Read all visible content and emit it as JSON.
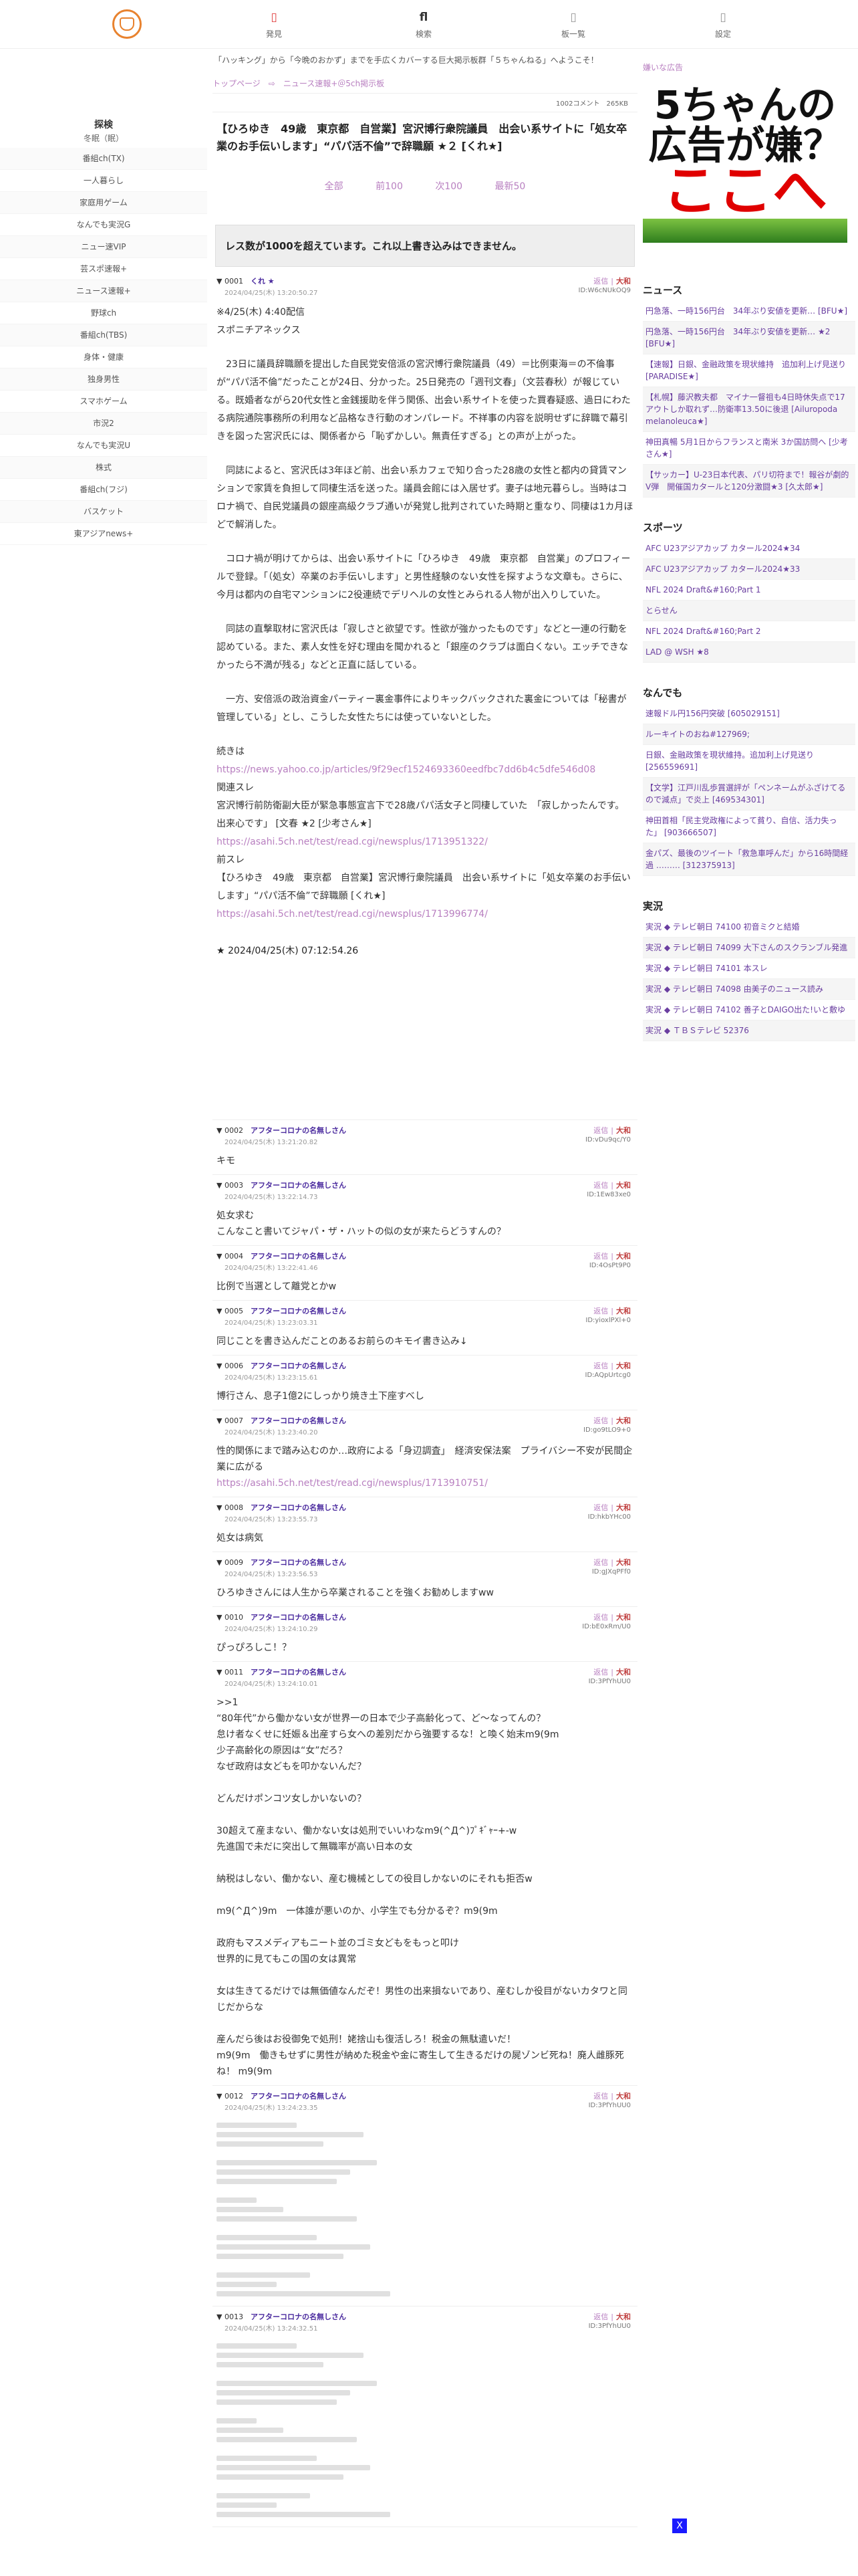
{
  "nav": {
    "items": [
      {
        "icon": "flame-icon",
        "glyph": "▯",
        "label": "発見"
      },
      {
        "icon": "bookmark-icon",
        "glyph": "fl",
        "label": "検索"
      },
      {
        "icon": "list-icon",
        "glyph": "▯",
        "label": "板一覧"
      },
      {
        "icon": "gear-icon",
        "glyph": "▯",
        "label": "設定"
      }
    ],
    "tagline": "「ハッキング」から「今晩のおかず」までを手広くカバーする巨大掲示板群「５ちゃんねる」へようこそ！"
  },
  "sidebar": {
    "heading": "探検",
    "subheading": "冬眠（眠）",
    "items": [
      "番組ch(TX)",
      "一人暮らし",
      "家庭用ゲーム",
      "なんでも実況G",
      "ニュー速VIP",
      "芸スポ速報+",
      "ニュース速報+",
      "野球ch",
      "番組ch(TBS)",
      "身体・健康",
      "独身男性",
      "スマホゲーム",
      "市況2",
      "なんでも実況U",
      "株式",
      "番組ch(フジ)",
      "バスケット",
      "東アジアnews+"
    ]
  },
  "main": {
    "breadcrumb": "トップページ　⇨　ニュース速報+＠5ch掲示板",
    "meta": "1002コメント　265KB",
    "title": "【ひろゆき　49歳　東京都　自営業】宮沢博行衆院議員　出会い系サイトに「処女卒業のお手伝いします」“パパ活不倫”で辞職願 ★２ [くれ★]",
    "pager": [
      "全部",
      "前100",
      "次100",
      "最新50"
    ],
    "warning": "レス数が1000を超えています。これ以上書き込みはできません。",
    "reply_label": "返信",
    "sep": "|",
    "flag_label": "大和"
  },
  "posts": [
    {
      "num": "0001",
      "name": "くれ ★",
      "date": "2024/04/25(木) 13:20:50.27",
      "id": "ID:W6cNUkOQ9",
      "lines": [
        "※4/25(木) 4:40配信",
        "スポニチアネックス",
        "",
        "　23日に議員辞職願を提出した自民党安倍派の宮沢博行衆院議員（49）＝比例東海＝の不倫事が“パパ活不倫”だったことが24日、分かった。25日発売の「週刊文春」（文芸春秋）が報じている。既婚者ながら20代女性と金銭援助を伴う関係、出会い系サイトを使った買春疑惑、過日にわたる病院通院事務所の利用など品格なき行動のオンパレード。不祥事の内容を説明せずに辞職で幕引きを図った宮沢氏には、関係者から「恥ずかしい。無責任すぎる」との声が上がった。",
        "",
        "　同誌によると、宮沢氏は3年ほど前、出会い系カフェで知り合った28歳の女性と都内の貸賃マンションで家賃を負担して同棲生活を送った。議員会館には入居せず。妻子は地元暮らし。当時はコロナ禍で、自民党議員の銀座高級クラブ通いが発覚し批判されていた時期と重なり、同棲は1カ月ほどで解消した。",
        "",
        "　コロナ禍が明けてからは、出会い系サイトに「ひろゆき　49歳　東京都　自営業」のプロフィールで登録。「（処女）卒業のお手伝いします」と男性経験のない女性を探すような文章も。さらに、今月は都内の自宅マンションに2役連続でデリヘルの女性とみられる人物が出入りしていた。",
        "",
        "　同誌の直撃取材に宮沢氏は「寂しさと欲望です。性欲が強かったものです」などと一連の行動を認めている。また、素人女性を好む理由を聞かれると「銀座のクラブは面白くない。エッチできなかったら不満が残る」などと正直に話している。",
        "",
        "　一方、安倍派の政治資金パーティー裏金事件によりキックバックされた裏金については「秘書が管理している」とし、こうした女性たちには使っていないとした。",
        "",
        "続きは"
      ],
      "links": [
        {
          "kind": "link",
          "text": "https://news.yahoo.co.jp/articles/9f29ecf1524693360eedfbc7dd6b4c5dfe546d08"
        },
        {
          "kind": "text",
          "text": "関連スレ"
        },
        {
          "kind": "text",
          "text": "宮沢博行前防衛副大臣が緊急事態宣言下で28歳パパ活女子と同棲していた　「寂しかったんです。出来心です」 [文春 ★2 [少考さん★]"
        },
        {
          "kind": "link",
          "text": "https://asahi.5ch.net/test/read.cgi/newsplus/1713951322/"
        },
        {
          "kind": "text",
          "text": "前スレ"
        },
        {
          "kind": "text",
          "text": "【ひろゆき　49歳　東京都　自営業】宮沢博行衆院議員　出会い系サイトに「処女卒業のお手伝いします」“パパ活不倫”で辞職願 [くれ★]"
        },
        {
          "kind": "link",
          "text": "https://asahi.5ch.net/test/read.cgi/newsplus/1713996774/"
        }
      ],
      "signature": "★ 2024/04/25(木) 07:12:54.26"
    },
    {
      "num": "0002",
      "name": "アフターコロナの名無しさん",
      "date": "2024/04/25(木) 13:21:20.82",
      "id": "ID:vDu9qc/Y0",
      "body": "キモ"
    },
    {
      "num": "0003",
      "name": "アフターコロナの名無しさん",
      "date": "2024/04/25(木) 13:22:14.73",
      "id": "ID:1Ew83xe0",
      "body": "処女求む\nこんなこと書いてジャパ・ザ・ハットの似の女が来たらどうすんの？"
    },
    {
      "num": "0004",
      "name": "アフターコロナの名無しさん",
      "date": "2024/04/25(木) 13:22:41.46",
      "id": "ID:4OsPt9P0",
      "body": "比例で当選として離党とかw"
    },
    {
      "num": "0005",
      "name": "アフターコロナの名無しさん",
      "date": "2024/04/25(木) 13:23:03.31",
      "id": "ID:yioxlPXl+0",
      "body": "同じことを書き込んだことのあるお前らのキモイ書き込み↓"
    },
    {
      "num": "0006",
      "name": "アフターコロナの名無しさん",
      "date": "2024/04/25(木) 13:23:15.61",
      "id": "ID:AQpUrtcg0",
      "body": "博行さん、息子1億2にしっかり焼き土下座すべし"
    },
    {
      "num": "0007",
      "name": "アフターコロナの名無しさん",
      "date": "2024/04/25(木) 13:23:40.20",
      "id": "ID:go9tLO9+0",
      "body": "性的関係にまで踏み込むのか…政府による「身辺調査」　経済安保法案　プライバシー不安が民間企業に広がる",
      "link": "https://asahi.5ch.net/test/read.cgi/newsplus/1713910751/"
    },
    {
      "num": "0008",
      "name": "アフターコロナの名無しさん",
      "date": "2024/04/25(木) 13:23:55.73",
      "id": "ID:hkbYHc00",
      "body": "処女は病気"
    },
    {
      "num": "0009",
      "name": "アフターコロナの名無しさん",
      "date": "2024/04/25(木) 13:23:56.53",
      "id": "ID:gJXqPFf0",
      "body": "ひろゆきさんには人生から卒業されることを強くお勧めしますww"
    },
    {
      "num": "0010",
      "name": "アフターコロナの名無しさん",
      "date": "2024/04/25(木) 13:24:10.29",
      "id": "ID:bE0xRm/U0",
      "body": "ぴっぴろしこ！？"
    },
    {
      "num": "0011",
      "name": "アフターコロナの名無しさん",
      "date": "2024/04/25(木) 13:24:10.01",
      "id": "ID:3PfYhUU0",
      "body": ">>1\n“80年代”から働かない女が世界一の日本で少子高齢化って、ど～なってんの？\n怠け者なくせに妊娠＆出産すら女への差別だから強要するな！と喚く始末m9(9m\n少子高齢化の原因は“女”だろ？\nなぜ政府は女どもを叩かないんだ？\n\nどんだけポンコツ女しかいないの？\n\n30超えて産まない、働かない女は処刑でいいわなm9(^Д^)ﾌﾟｷﾞｬｰ+-w\n先進国で未だに突出して無職率が高い日本の女\n\n納税はしない、働かない、産む機械としての役目しかないのにそれも拒否w\n\nm9(^Д^)9m　一体誰が悪いのか、小学生でも分かるぞ？m9(9m\n\n政府もマスメディアもニート並のゴミ女どもをもっと叩け\n世界的に見てもこの国の女は異常\n\n女は生きてるだけでは無価値なんだぞ！男性の出来損ないであり、産むしか役目がないカタワと同じだからな\n\n産んだら後はお役御免で処刑！姥捨山も復活しろ！税金の無駄遣いだ！\nm9(9m　働きもせずに男性が納めた税金や金に寄生して生きるだけの屍ゾンビ死ね！廃人雌豚死ね！ m9(9m"
    },
    {
      "num": "0012",
      "name": "アフターコロナの名無しさん",
      "date": "2024/04/25(木) 13:24:23.35",
      "id": "ID:3PfYhUU0",
      "quoted": true
    },
    {
      "num": "0013",
      "name": "アフターコロナの名無しさん",
      "date": "2024/04/25(木) 13:24:32.51",
      "id": "ID:3PfYhUU0",
      "quoted": true
    }
  ],
  "right": {
    "ad_note": "嫌いな広告",
    "ad_line1": "5ちゃんの",
    "ad_line2": "広告が嫌？",
    "ad_line3": "ここへ",
    "news_title": "ニュース",
    "news": [
      "円急落、一時156円台　34年ぶり安値を更新… [BFU★]",
      "円急落、一時156円台　34年ぶり安値を更新… ★2 [BFU★]",
      "【速報】日銀、金融政策を現状維持　追加利上げ見送り [PARADISE★]",
      "【札幌】藤沢教夫都　マイナ一督祖も4日時休失点で17アウトしか取れず…防衛率13.50に後退 [Ailuropoda melanoleuca★]",
      "神田真暢 5月1日からフランスと南米 3か国訪問へ [少考さん★]",
      "【サッカー】U-23日本代表、パリ切符まで！報谷が劇的V弾　開催国カタールと120分激闘★3 [久太郎★]"
    ],
    "sports_title": "スポーツ",
    "sports": [
      "AFC U23アジアカップ カタール2024★34",
      "AFC U23アジアカップ カタール2024★33",
      "NFL 2024 Draft&#160;Part 1",
      "とらせん",
      "NFL 2024 Draft&#160;Part 2",
      "LAD @ WSH ★8"
    ],
    "misc_title": "なんでも",
    "misc": [
      "速報ドル円156円突破 [605029151]",
      "ルーキイトのおね#127969;",
      "日銀、金融政策を現状維持。追加利上げ見送り [256559691]",
      "【文学】江戸川乱歩賞選評が「ペンネームがふざけてるので減点」で炎上 [469534301]",
      "神田首相「民主党政権によって貧り、自信、活力失った」 [903666507]",
      "金パズ、最後のツイート「救急車呼んだ」から16時間経過 ……… [312375913]"
    ],
    "live_title": "実況",
    "live": [
      "実況 ◆ テレビ朝日 74100 初音ミクと結婚",
      "実況 ◆ テレビ朝日 74099 大下さんのスクランブル発進",
      "実況 ◆ テレビ朝日 74101 本スレ",
      "実況 ◆ テレビ朝日 74098 由美子のニュース読み",
      "実況 ◆ テレビ朝日 74102 善子とDAIGO出た!いと敷ゆ",
      "実況 ◆ ＴＢＳテレビ 52376"
    ]
  },
  "scrolltop": "X"
}
